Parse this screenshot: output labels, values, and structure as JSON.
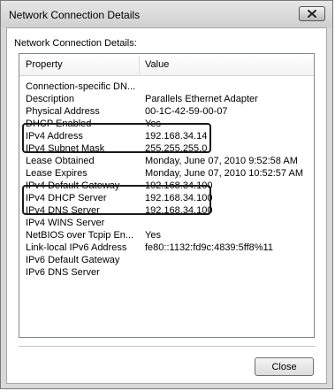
{
  "window": {
    "title": "Network Connection Details"
  },
  "group_label": "Network Connection Details:",
  "table": {
    "columns": [
      "Property",
      "Value"
    ],
    "rows": [
      {
        "property": "Connection-specific DN...",
        "value": ""
      },
      {
        "property": "Description",
        "value": "Parallels Ethernet Adapter"
      },
      {
        "property": "Physical Address",
        "value": "00-1C-42-59-00-07"
      },
      {
        "property": "DHCP Enabled",
        "value": "Yes"
      },
      {
        "property": "IPv4 Address",
        "value": "192.168.34.14"
      },
      {
        "property": "IPv4 Subnet Mask",
        "value": "255.255.255.0"
      },
      {
        "property": "Lease Obtained",
        "value": "Monday, June 07, 2010 9:52:58 AM"
      },
      {
        "property": "Lease Expires",
        "value": "Monday, June 07, 2010 10:52:57 AM"
      },
      {
        "property": "IPv4 Default Gateway",
        "value": "192.168.34.100"
      },
      {
        "property": "IPv4 DHCP Server",
        "value": "192.168.34.100"
      },
      {
        "property": "IPv4 DNS Server",
        "value": "192.168.34.100"
      },
      {
        "property": "IPv4 WINS Server",
        "value": ""
      },
      {
        "property": "NetBIOS over Tcpip En...",
        "value": "Yes"
      },
      {
        "property": "Link-local IPv6 Address",
        "value": "fe80::1132:fd9c:4839:5ff8%11"
      },
      {
        "property": "IPv6 Default Gateway",
        "value": ""
      },
      {
        "property": "IPv6 DNS Server",
        "value": ""
      }
    ]
  },
  "buttons": {
    "close_label": "Close"
  },
  "icons": {
    "window_close": "close-icon"
  }
}
